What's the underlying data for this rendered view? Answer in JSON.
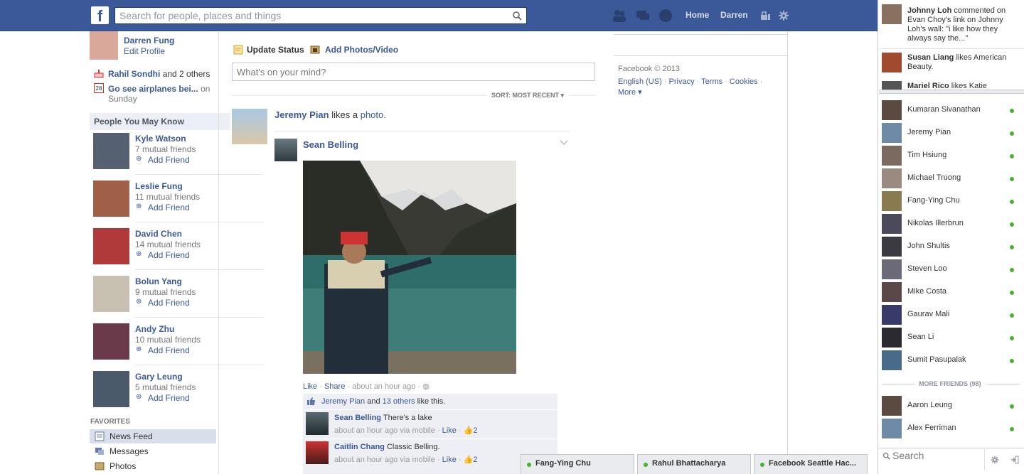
{
  "header": {
    "logo": "f",
    "search_placeholder": "Search for people, places and things",
    "nav": {
      "home": "Home",
      "profile": "Darren"
    }
  },
  "left": {
    "user_name": "Darren Fung",
    "edit_profile": "Edit Profile",
    "birthday": {
      "name": "Rahil Sondhi",
      "rest": "and 2 others"
    },
    "event": {
      "title": "Go see airplanes bei...",
      "on": "on",
      "day": "Sunday",
      "date_num": "28"
    },
    "pymk_title": "People You May Know",
    "pymk": [
      {
        "name": "Kyle Watson",
        "mutual": "7 mutual friends",
        "action": "Add Friend"
      },
      {
        "name": "Leslie Fung",
        "mutual": "11 mutual friends",
        "action": "Add Friend"
      },
      {
        "name": "David Chen",
        "mutual": "14 mutual friends",
        "action": "Add Friend"
      },
      {
        "name": "Bolun Yang",
        "mutual": "9 mutual friends",
        "action": "Add Friend"
      },
      {
        "name": "Andy Zhu",
        "mutual": "10 mutual friends",
        "action": "Add Friend"
      },
      {
        "name": "Gary Leung",
        "mutual": "5 mutual friends",
        "action": "Add Friend"
      }
    ],
    "favorites_title": "FAVORITES",
    "favorites": [
      "News Feed",
      "Messages",
      "Photos"
    ]
  },
  "composer": {
    "update_status": "Update Status",
    "add_photos": "Add Photos/Video",
    "placeholder": "What's on your mind?",
    "sort": "SORT: MOST RECENT"
  },
  "story": {
    "actor": "Jeremy Pian",
    "verb": "likes a",
    "object": "photo."
  },
  "post": {
    "author": "Sean Belling",
    "like": "Like",
    "share": "Share",
    "time": "about an hour ago",
    "likers": "Jeremy Pian",
    "likers_and": "and",
    "likers_others": "13 others",
    "likers_tail": "like this.",
    "comments": [
      {
        "name": "Sean Belling",
        "text": "There's a lake",
        "meta": "about an hour ago via mobile",
        "like": "Like",
        "count": "2"
      },
      {
        "name": "Caitlin Chang",
        "text": "Classic Belling.",
        "meta": "about an hour ago via mobile",
        "like": "Like",
        "count": "2"
      }
    ]
  },
  "rightcol": {
    "copyright": "Facebook © 2013",
    "links": [
      "English (US)",
      "Privacy",
      "Terms",
      "Cookies"
    ],
    "more": "More"
  },
  "ticker": [
    {
      "name": "Johnny Loh",
      "text": "commented on Evan Choy's link on Johnny Loh's wall: \"i like how they always say the...\""
    },
    {
      "name": "Susan Liang",
      "text": "likes American Beauty."
    },
    {
      "name": "Mariel Rico",
      "text": "likes Katie"
    }
  ],
  "chat": {
    "friends": [
      "Kumaran Sivanathan",
      "Jeremy Pian",
      "Tim Hsiung",
      "Michael Truong",
      "Fang-Ying Chu",
      "Nikolas Illerbrun",
      "John Shultis",
      "Steven Loo",
      "Mike Costa",
      "Gaurav Mali",
      "Sean Li",
      "Sumit Pasupalak"
    ],
    "more_friends": "MORE FRIENDS (98)",
    "more_list": [
      "Aaron Leung",
      "Alex Ferriman"
    ],
    "search": "Search"
  },
  "chat_tabs": [
    "Fang-Ying Chu",
    "Rahul Bhattacharya",
    "Facebook Seattle Hac..."
  ],
  "colors": {
    "brand": "#3b5998",
    "online": "#42b72a"
  }
}
